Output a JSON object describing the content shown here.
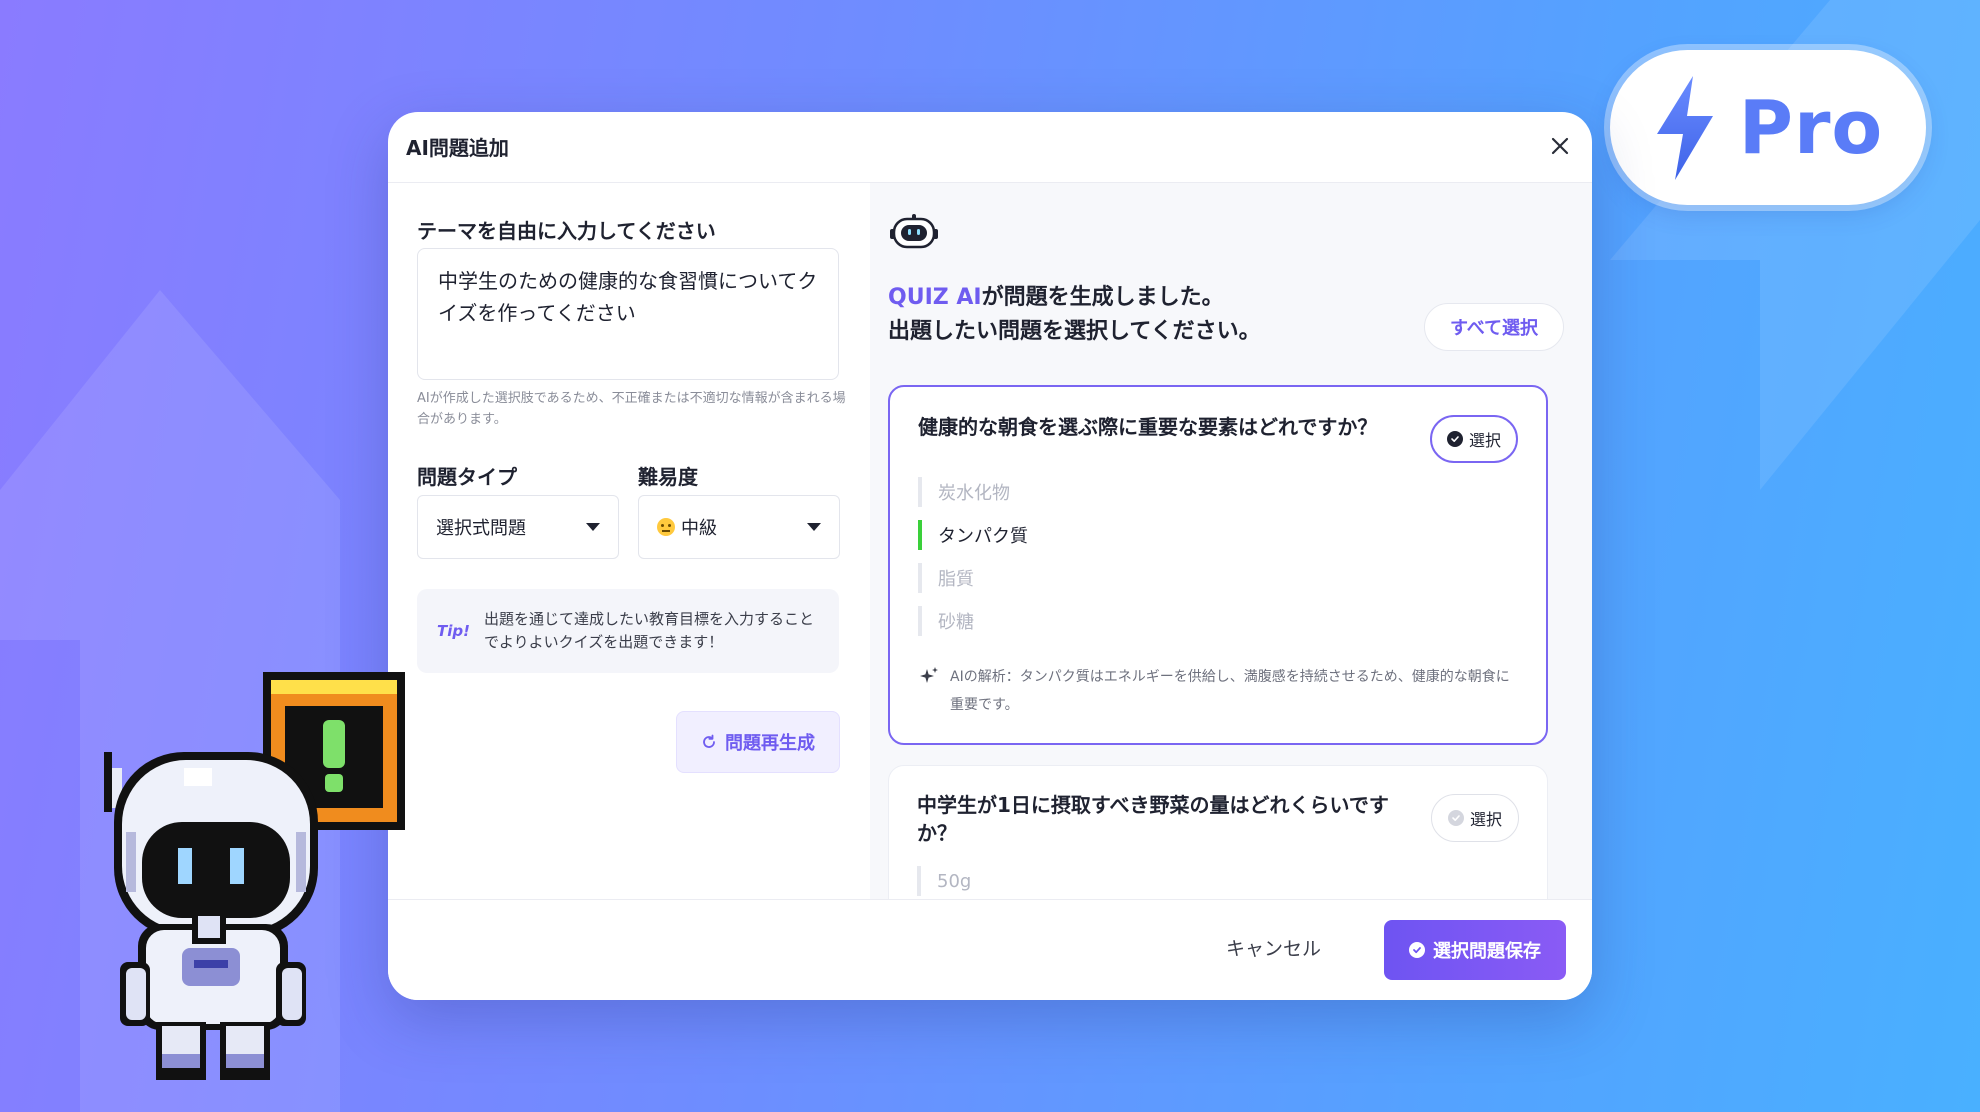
{
  "badge": {
    "label": "Pro"
  },
  "modal": {
    "title": "AI問題追加",
    "close_icon": "close-icon"
  },
  "form": {
    "theme_label": "テーマを自由に入力してください",
    "theme_value": "中学生のための健康的な食習慣についてクイズを作ってください",
    "disclaimer": "AIが作成した選択肢であるため、不正確または不適切な情報が含まれる場合があります。",
    "type_label": "問題タイプ",
    "type_value": "選択式問題",
    "level_label": "難易度",
    "level_value": "中級",
    "tip_tag": "Tip!",
    "tip_text": "出題を通じて達成したい教育目標を入力することでよりよいクイズを出題できます！",
    "regen_label": "問題再生成"
  },
  "results": {
    "brand": "QUIZ AI",
    "line1_rest": "が問題を生成しました。",
    "line2": "出題したい問題を選択してください。",
    "select_all_label": "すべて選択",
    "questions": [
      {
        "title": "健康的な朝食を選ぶ際に重要な要素はどれですか？",
        "pick_label": "選択",
        "selected": true,
        "options": [
          {
            "text": "炭水化物",
            "correct": false
          },
          {
            "text": "タンパク質",
            "correct": true
          },
          {
            "text": "脂質",
            "correct": false
          },
          {
            "text": "砂糖",
            "correct": false
          }
        ],
        "explanation": "AIの解析：タンパク質はエネルギーを供給し、満腹感を持続させるため、健康的な朝食に重要です。"
      },
      {
        "title": "中学生が1日に摂取すべき野菜の量はどれくらいですか？",
        "pick_label": "選択",
        "selected": false,
        "options": [
          {
            "text": "50g",
            "correct": false
          }
        ]
      }
    ]
  },
  "footer": {
    "cancel_label": "キャンセル",
    "save_label": "選択問題保存"
  },
  "colors": {
    "accent": "#6f5cf0",
    "correct": "#3ad03a",
    "pro": "#5a7cf7"
  }
}
